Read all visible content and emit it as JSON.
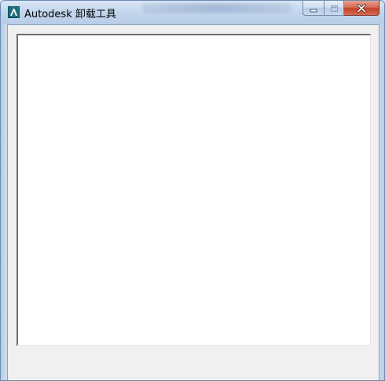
{
  "window": {
    "title": "Autodesk 卸载工具",
    "app_icon": "autodesk-a-icon",
    "controls": {
      "minimize_icon": "minimize-icon",
      "maximize_icon": "maximize-icon",
      "close_icon": "close-icon"
    }
  },
  "main": {
    "list_items": []
  },
  "colors": {
    "titlebar": "#c3d6ec",
    "close_button": "#c2432a",
    "client_background": "#f0f0f0",
    "list_background": "#ffffff"
  }
}
